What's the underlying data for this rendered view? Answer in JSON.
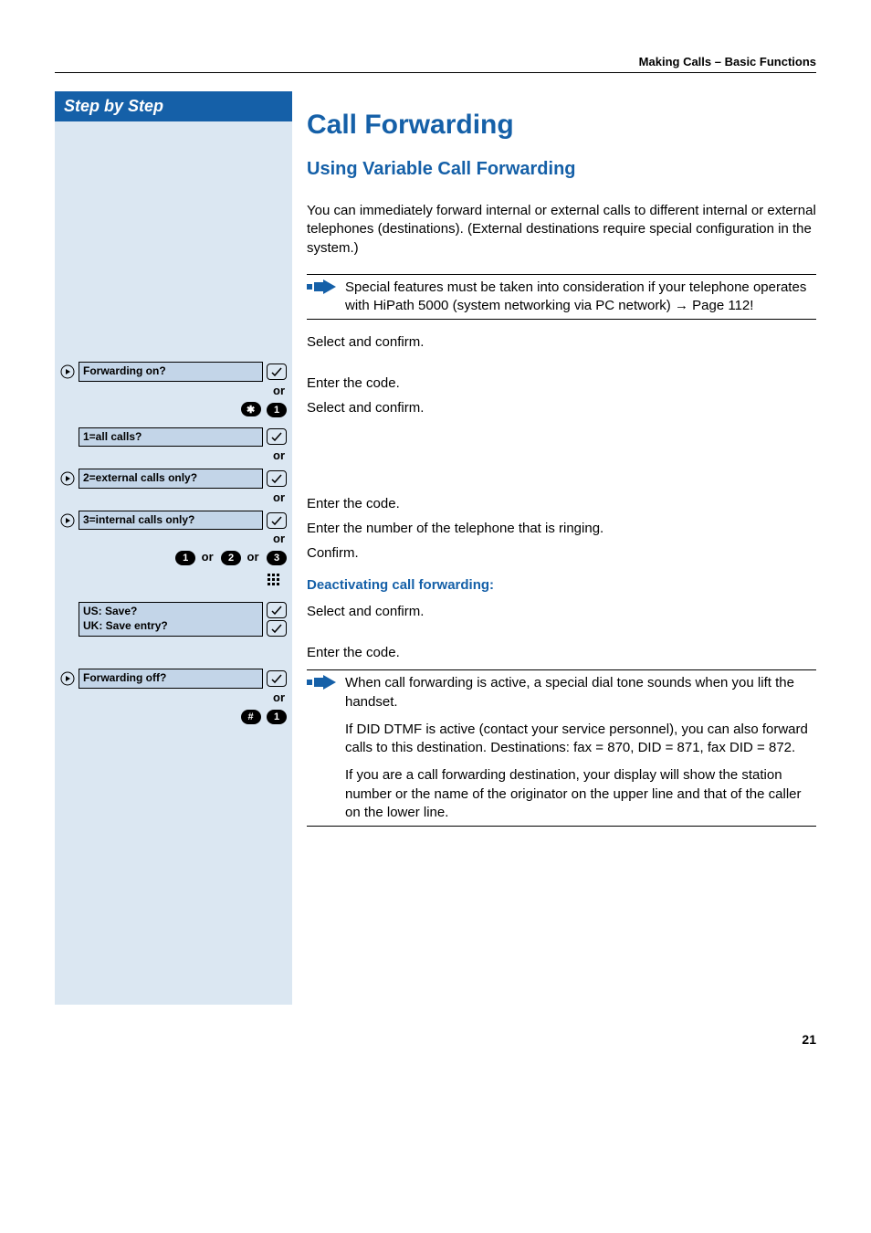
{
  "header": "Making Calls – Basic Functions",
  "left_header": "Step by Step",
  "title": "Call Forwarding",
  "subtitle": "Using Variable Call Forwarding",
  "intro": "You can immediately forward internal or external calls to different internal or external telephones (destinations). (External destinations require special configuration in the system.)",
  "note1": "Special features must be taken into consideration if your telephone operates with HiPath 5000 (system networking via PC network) → Page 112!",
  "or": "or",
  "displays": {
    "fw_on": "Forwarding on?",
    "all_calls": "1=all calls?",
    "ext_only": "2=external calls only?",
    "int_only": "3=internal calls only?",
    "save_us": "US: Save?",
    "save_uk": "UK: Save entry?",
    "fw_off": "Forwarding off?"
  },
  "keys": {
    "star": "✱",
    "hash": "#",
    "one": "1",
    "two": "2",
    "three": "3"
  },
  "steps": {
    "select_confirm": "Select and confirm.",
    "enter_code": "Enter the code.",
    "enter_number": "Enter the number of the telephone that is ringing.",
    "confirm": "Confirm."
  },
  "deactivate_title": "Deactivating call forwarding:",
  "note2a": "When call forwarding is active, a special dial tone sounds when you lift the handset.",
  "note2b": "If DID DTMF is active (contact your service personnel), you can also forward calls to this destination. Destinations: fax = 870, DID = 871, fax DID = 872.",
  "note2c": "If you are a call forwarding destination, your display will show the station number or the name of the originator on the upper line and that of the caller on the lower line.",
  "page": "21"
}
